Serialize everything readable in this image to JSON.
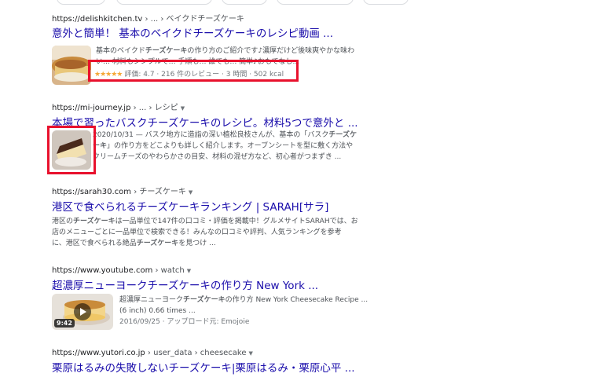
{
  "results": [
    {
      "site": "https://delishkitchen.tv",
      "path": " › ... › ベイクドチーズケーキ",
      "title": "意外と簡単！ 基本のベイクドチーズケーキのレシピ動画 ...",
      "snippet_parts": [
        "基本のベイクド",
        "チーズケーキ",
        "の作り方のご紹介です♪濃厚だけど後味爽やかな味わ",
        "い… 材料もシンプルで… 手順も… 誰でも… 簡単♪おもてなし..."
      ],
      "rating_stars": "★★★★★",
      "rating_text": "評価: 4.7 · 216 件のレビュー · 3 時間 · 502 kcal",
      "rating_value": 4.7,
      "thumbnail_icon": "cheesecake-image"
    },
    {
      "site": "https://mi-journey.jp",
      "path": " › ... › レシピ",
      "title": "本場で習ったバスクチーズケーキのレシピ。材料5つで意外と ...",
      "snippet_date": "2020/10/31",
      "snippet_parts": [
        " — バスク地方に造詣の深い植松良枝さんが、基本の「バスク",
        "チーズケ",
        "ーキ",
        "」の作り方をどこよりも詳しく紹介します。オーブンシートを型に敷く方法や",
        "クリームチーズのやわらかさの目安、材料の混ぜ方など、初心者がつまずき ..."
      ],
      "thumbnail_icon": "basque-cheesecake-image"
    },
    {
      "site": "https://sarah30.com",
      "path": " › チーズケーキ",
      "title": "港区で食べられるチーズケーキランキング | SARAH[サラ]",
      "snippet_parts": [
        "港区の",
        "チーズケーキ",
        "は一品単位で147件の口コミ・評価を掲載中！グルメサイトSARAHでは、お",
        "店のメニューごとに一品単位で検索できる！みんなの口コミや評判、人気ランキングを参考",
        "に、港区で食べられる絶品",
        "チーズケーキ",
        "を見つけ ..."
      ]
    },
    {
      "site": "https://www.youtube.com",
      "path": " › watch",
      "title": "超濃厚ニューヨークチーズケーキの作り方 New York ...",
      "video_desc_parts": [
        "超濃厚ニューヨーク",
        "チーズケーキ",
        "の作り方 New York Cheesecake Recipe ..."
      ],
      "video_line2": "(6 inch) 0.66 times ...",
      "video_meta": "2016/09/25 · アップロード元: Emojoie",
      "duration": "9:42",
      "thumbnail_icon": "video-thumbnail-cheesecake"
    },
    {
      "site": "https://www.yutori.co.jp",
      "path": " › user_data › cheesecake",
      "title": "栗原はるみの失敗しないチーズケーキ|栗原はるみ・栗原心平 ..."
    }
  ],
  "colors": {
    "link": "#1a0dab",
    "highlight_box": "#e8112d",
    "stars": "#f4a836"
  }
}
